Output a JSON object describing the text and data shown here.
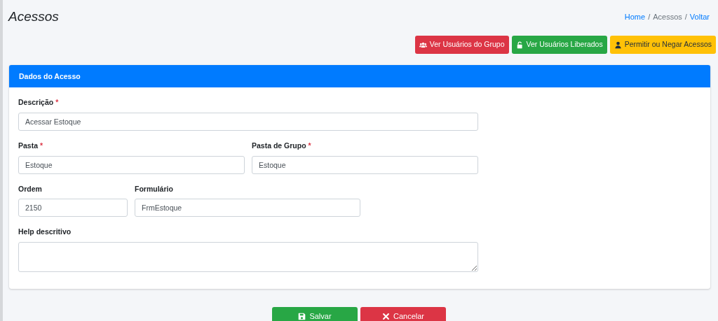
{
  "page_title": "Acessos",
  "breadcrumb": [
    {
      "label": "Home",
      "kind": "link"
    },
    {
      "separator": "/",
      "label": "Acessos",
      "kind": "current"
    },
    {
      "separator": "/",
      "label": "Voltar",
      "kind": "link"
    }
  ],
  "actions": [
    {
      "label": "Ver Usuários do Grupo",
      "kind": "danger"
    },
    {
      "label": "Ver Usuários Liberados",
      "kind": "success"
    },
    {
      "label": "Permitir ou Negar Acessos",
      "kind": "warning"
    }
  ],
  "card": {
    "title": "Dados do Acesso",
    "rows": [
      [
        {
          "label": "Descrição",
          "required_mark": "*",
          "value": "Acessar Estoque",
          "kind": "input"
        }
      ],
      [
        {
          "label": "Pasta",
          "required_mark": "*",
          "value": "Estoque",
          "kind": "input"
        },
        {
          "label": "Pasta de Grupo",
          "required_mark": "*",
          "value": "Estoque",
          "kind": "input"
        }
      ],
      [
        {
          "label": "Ordem",
          "value": "2150",
          "kind": "input"
        },
        {
          "label": "Formulário",
          "value": "FrmEstoque",
          "kind": "input"
        }
      ],
      [
        {
          "label": "Help descritivo",
          "kind": "textarea"
        }
      ]
    ]
  },
  "footer_buttons": [
    {
      "label": "Salvar",
      "kind": "success"
    },
    {
      "label": "Cancelar",
      "kind": "danger"
    }
  ]
}
